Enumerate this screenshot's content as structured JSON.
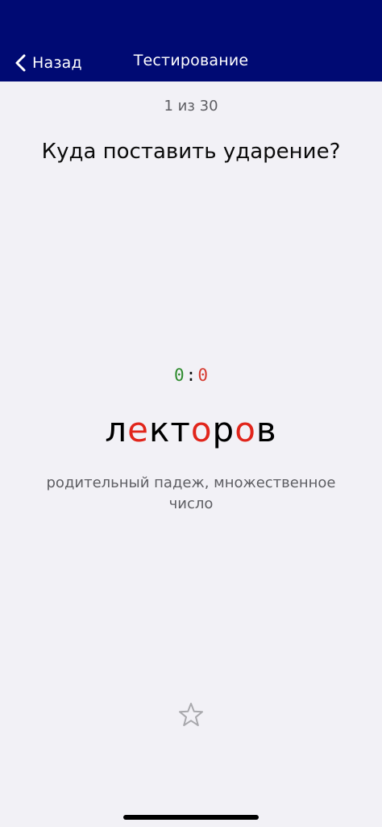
{
  "navbar": {
    "back_label": "Назад",
    "title": "Тестирование",
    "background_color": "#000a73"
  },
  "progress": {
    "text": "1 из 30"
  },
  "question": {
    "text": "Куда поставить ударение?"
  },
  "score": {
    "correct": "0",
    "separator": ":",
    "wrong": "0"
  },
  "word": {
    "letters": [
      {
        "char": "л",
        "is_vowel": false
      },
      {
        "char": "е",
        "is_vowel": true
      },
      {
        "char": "к",
        "is_vowel": false
      },
      {
        "char": "т",
        "is_vowel": false
      },
      {
        "char": "о",
        "is_vowel": true
      },
      {
        "char": "р",
        "is_vowel": false
      },
      {
        "char": "о",
        "is_vowel": true
      },
      {
        "char": "в",
        "is_vowel": false
      }
    ],
    "vowel_color": "#e1251b"
  },
  "hint": {
    "text": "родительный падеж, множественное число"
  },
  "favorite": {
    "icon": "star-outline-icon"
  }
}
